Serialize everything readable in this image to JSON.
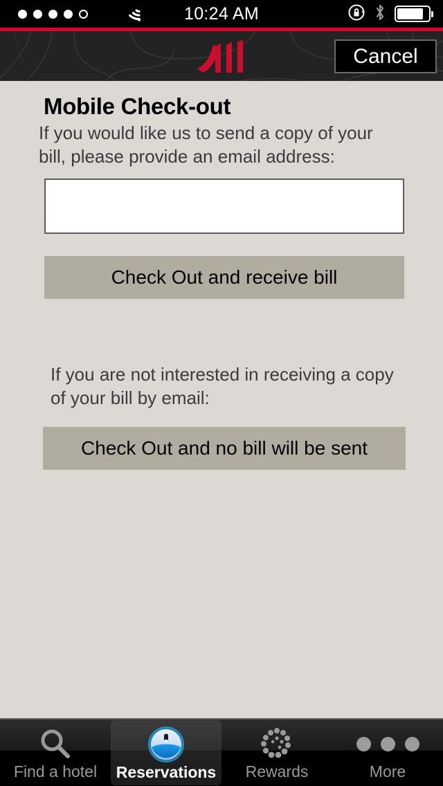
{
  "status_bar": {
    "signal_dots_filled": 4,
    "signal_dots_total": 5,
    "wifi_icon": "wifi-icon",
    "time": "10:24 AM",
    "rotation_lock_icon": "rotation-lock-icon",
    "bluetooth_icon": "bluetooth-icon",
    "battery_icon": "battery-icon",
    "battery_level_percent": 84
  },
  "header": {
    "logo_alt": "marriott-logo",
    "cancel_label": "Cancel",
    "background": "dark-map-pattern"
  },
  "content": {
    "page_title": "Mobile Check-out",
    "intro_text": "If you would like us to send a copy of your bill, please provide an email address:",
    "email_value": "",
    "email_placeholder": "",
    "primary_button_label": "Check Out and receive bill",
    "secondary_text": "If you are not interested in receiving a copy of your bill by email:",
    "secondary_button_label": "Check Out and no bill will be sent"
  },
  "tab_bar": {
    "tabs": [
      {
        "label": "Find a hotel",
        "icon": "search-icon",
        "active": false
      },
      {
        "label": "Reservations",
        "icon": "reservation-badge-icon",
        "active": true
      },
      {
        "label": "Rewards",
        "icon": "rewards-spiral-icon",
        "active": false
      },
      {
        "label": "More",
        "icon": "more-dots-icon",
        "active": false
      }
    ]
  },
  "colors": {
    "brand_red": "#c8102e",
    "page_background": "#dcd9d5",
    "button_khaki": "#b0ada0",
    "header_dark": "#232323",
    "tab_active_blue": "#2aa8ef"
  }
}
